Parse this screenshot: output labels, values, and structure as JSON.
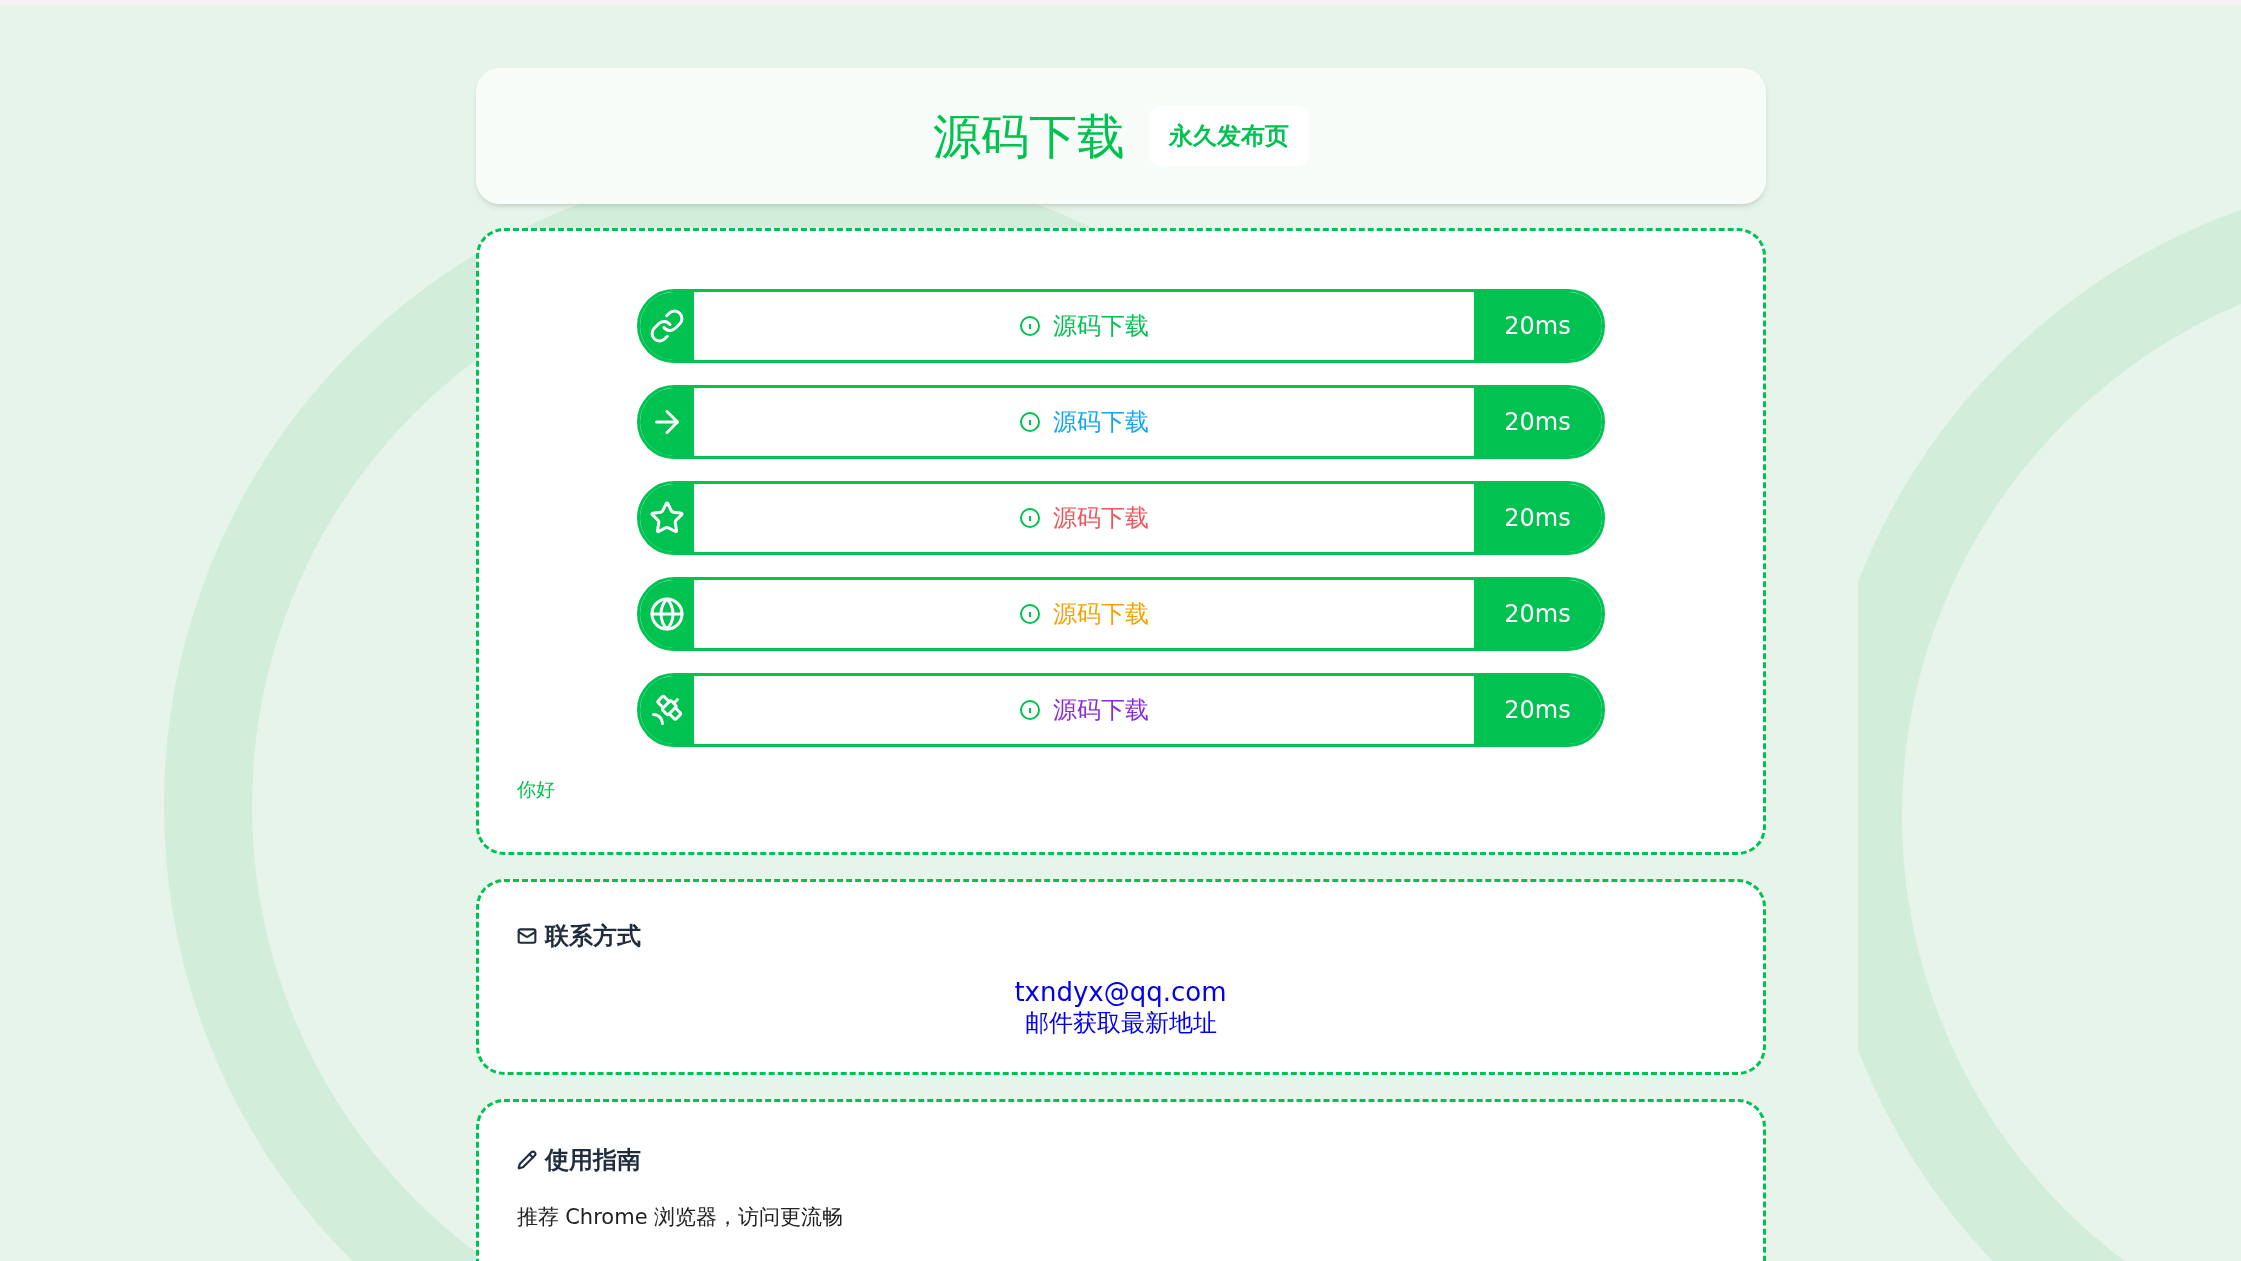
{
  "header": {
    "title": "源码下载",
    "badge": "永久发布页"
  },
  "links": [
    {
      "label": "源码下载",
      "color": "#00c250",
      "latency": "20ms"
    },
    {
      "label": "源码下载",
      "color": "#10a6f0",
      "latency": "20ms"
    },
    {
      "label": "源码下载",
      "color": "#f2545b",
      "latency": "20ms"
    },
    {
      "label": "源码下载",
      "color": "#f5a300",
      "latency": "20ms"
    },
    {
      "label": "源码下载",
      "color": "#8a2be2",
      "latency": "20ms"
    }
  ],
  "note": "你好",
  "contact": {
    "title": "联系方式",
    "email": "txndyx@qq.com",
    "hint": "邮件获取最新地址"
  },
  "guide": {
    "title": "使用指南",
    "text": "推荐 Chrome 浏览器，访问更流畅"
  }
}
